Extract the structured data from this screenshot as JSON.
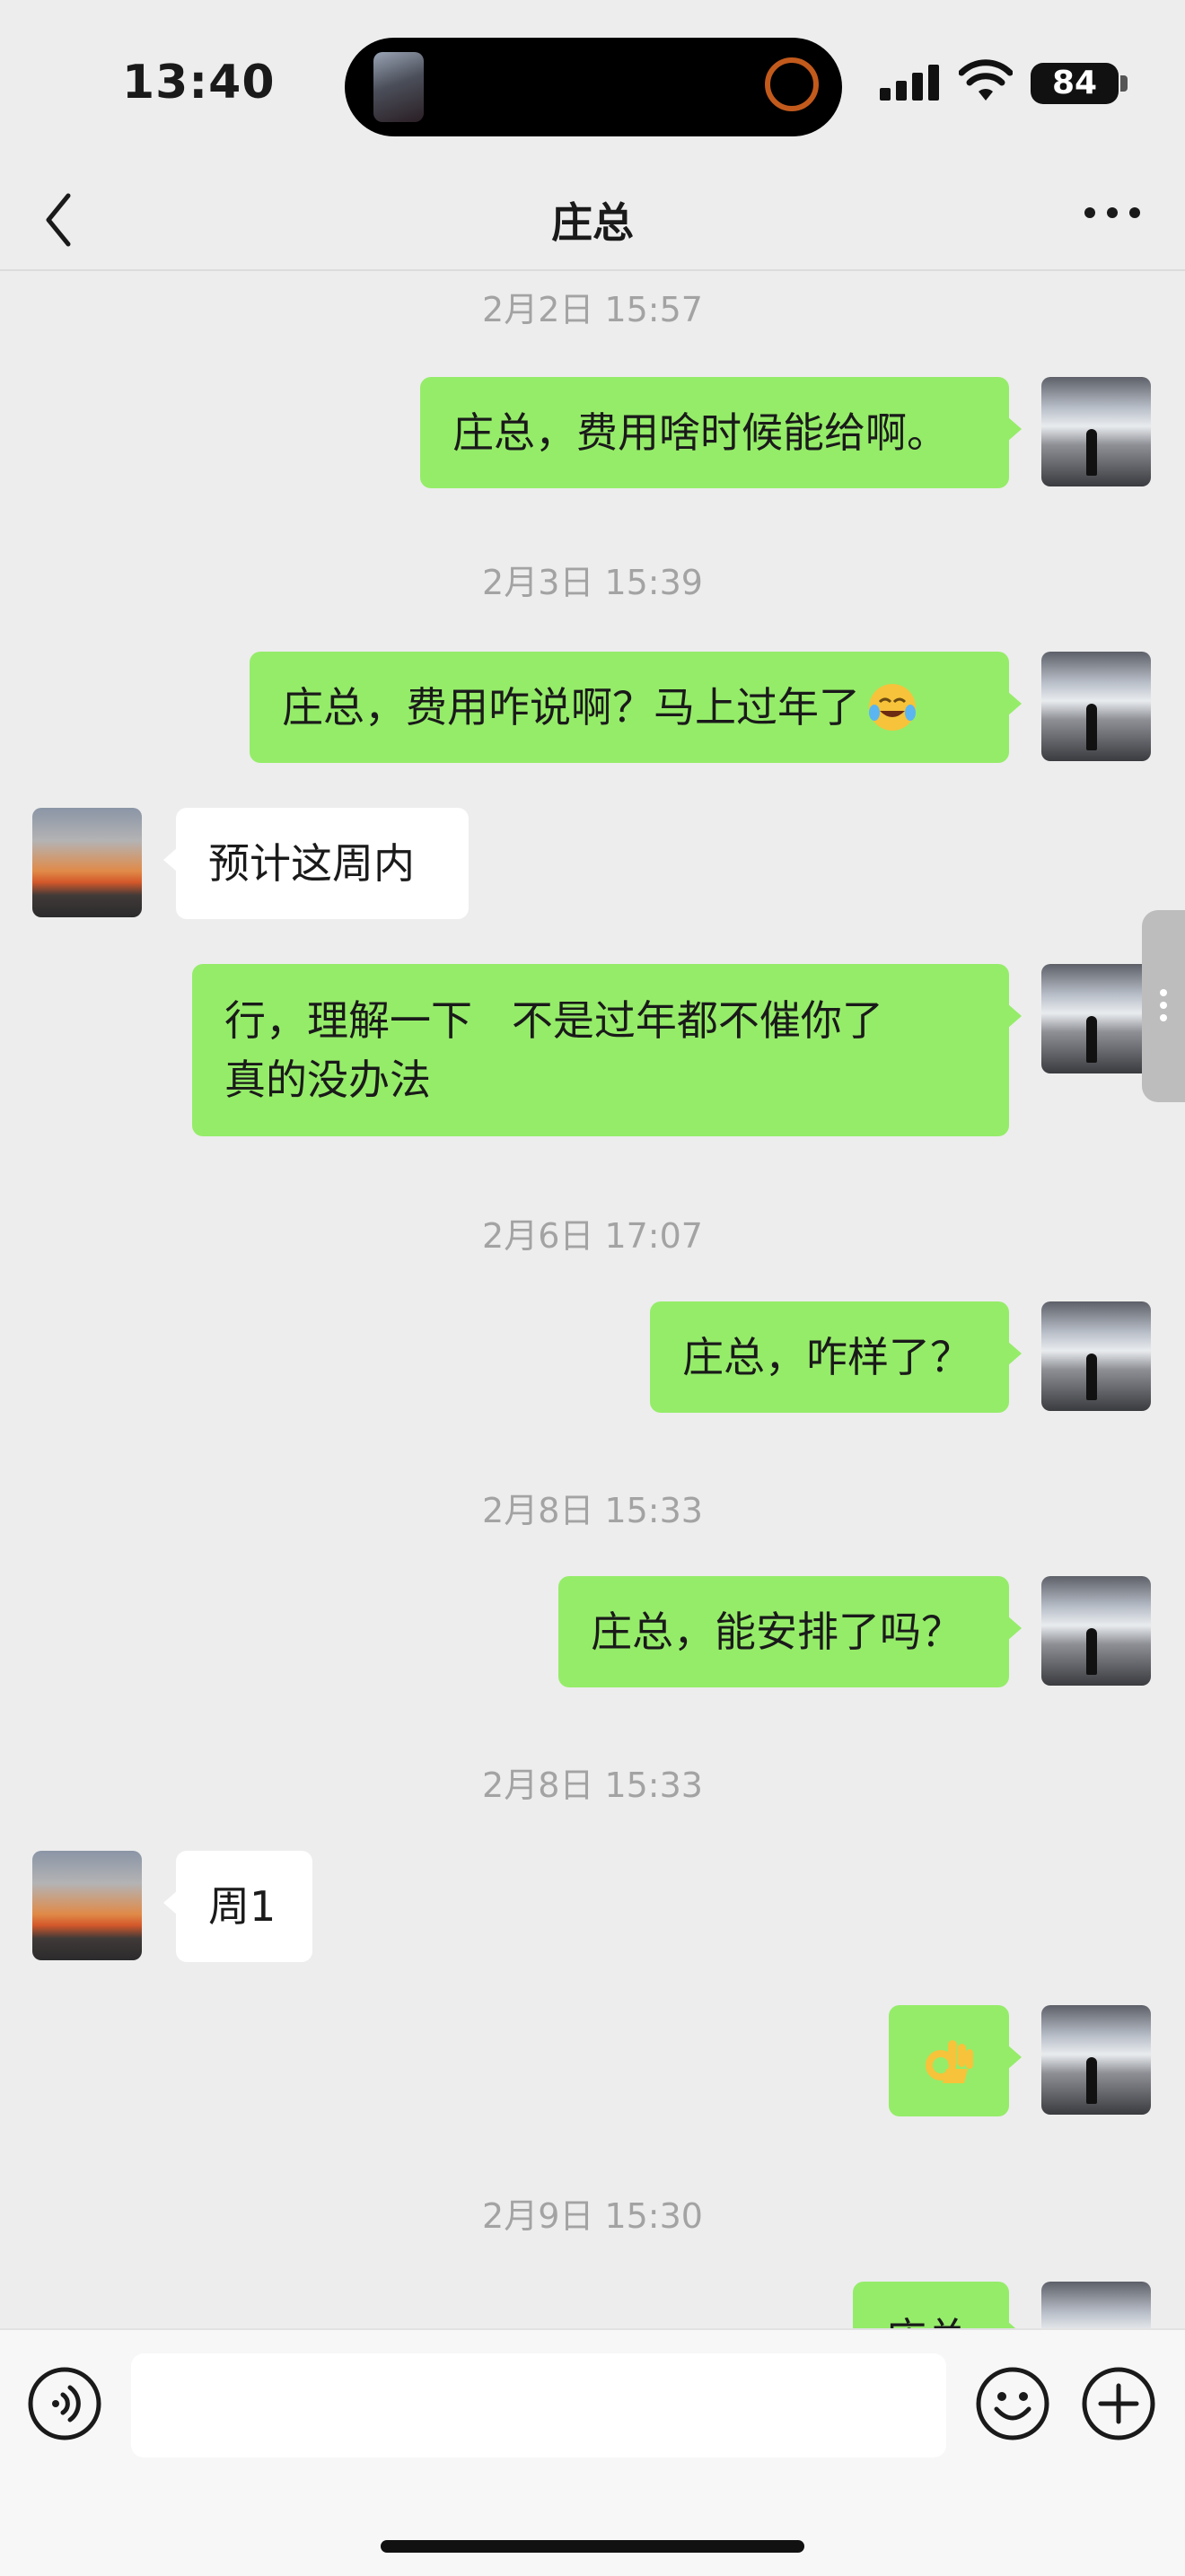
{
  "status_bar": {
    "time": "13:40",
    "battery": "84"
  },
  "nav": {
    "title": "庄总"
  },
  "messages": [
    {
      "type": "timestamp",
      "text": "2月2日 15:57"
    },
    {
      "type": "sent",
      "text": "庄总，费用啥时候能给啊。"
    },
    {
      "type": "timestamp",
      "text": "2月3日 15:39"
    },
    {
      "type": "sent",
      "text": "庄总，费用咋说啊？马上过年了",
      "emoji": "crying-laughing-emoji-icon"
    },
    {
      "type": "received",
      "text": "预计这周内"
    },
    {
      "type": "sent",
      "text": "行，理解一下   不是过年都不催你了\n真的没办法"
    },
    {
      "type": "timestamp",
      "text": "2月6日 17:07"
    },
    {
      "type": "sent",
      "text": "庄总，咋样了？"
    },
    {
      "type": "timestamp",
      "text": "2月8日 15:33"
    },
    {
      "type": "sent",
      "text": "庄总，能安排了吗？"
    },
    {
      "type": "timestamp",
      "text": "2月8日 15:33"
    },
    {
      "type": "received",
      "text": "周1"
    },
    {
      "type": "sent",
      "text": "",
      "emoji": "ok-hand-emoji-icon"
    },
    {
      "type": "timestamp",
      "text": "2月9日 15:30"
    },
    {
      "type": "sent",
      "text": "庄总"
    }
  ],
  "colors": {
    "sent_bubble": "#95ec69",
    "received_bubble": "#ffffff",
    "background": "#ededed"
  }
}
